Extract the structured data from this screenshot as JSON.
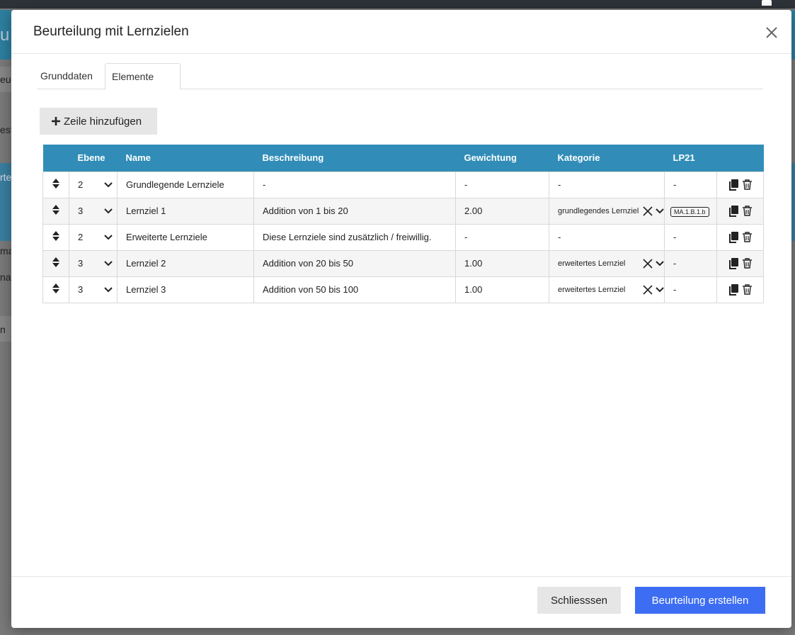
{
  "modal": {
    "title": "Beurteilung mit Lernzielen",
    "tabs": [
      {
        "label": "Grunddaten"
      },
      {
        "label": "Elemente"
      }
    ],
    "add_row_label": "Zeile hinzufügen",
    "columns": [
      "",
      "Ebene",
      "Name",
      "Beschreibung",
      "Gewichtung",
      "Kategorie",
      "LP21",
      ""
    ],
    "rows": [
      {
        "ebene": "2",
        "name": "Grundlegende Lernziele",
        "beschreibung": "-",
        "gewichtung": "-",
        "kategorie": "-",
        "lp21": "-"
      },
      {
        "ebene": "3",
        "name": "Lernziel 1",
        "beschreibung": "Addition von 1 bis 20",
        "gewichtung": "2.00",
        "kategorie": "grundlegendes Lernziel",
        "lp21": "MA.1.B.1.b"
      },
      {
        "ebene": "2",
        "name": "Erweiterte Lernziele",
        "beschreibung": "Diese Lernziele sind zusätzlich / freiwillig.",
        "gewichtung": "-",
        "kategorie": "-",
        "lp21": "-"
      },
      {
        "ebene": "3",
        "name": "Lernziel 2",
        "beschreibung": "Addition von 20 bis 50",
        "gewichtung": "1.00",
        "kategorie": "erweitertes Lernziel",
        "lp21": "-"
      },
      {
        "ebene": "3",
        "name": "Lernziel 3",
        "beschreibung": "Addition von 50 bis 100",
        "gewichtung": "1.00",
        "kategorie": "erweitertes Lernziel",
        "lp21": "-"
      }
    ],
    "footer": {
      "close_label": "Schliesssen",
      "create_label": "Beurteilung erstellen"
    }
  },
  "background": {
    "fragments": [
      "u",
      "eu",
      "est",
      "rte",
      "na",
      "ma",
      "n"
    ]
  },
  "colors": {
    "header_blue": "#318db8",
    "primary": "#3d6df2"
  }
}
